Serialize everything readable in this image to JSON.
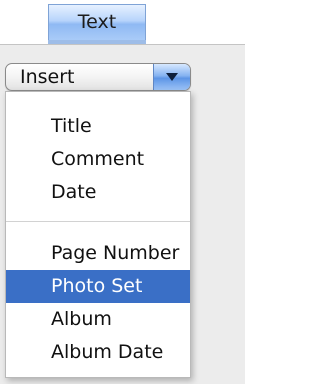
{
  "tab": {
    "label": "Text"
  },
  "popup": {
    "selected_value": "Insert",
    "arrow_icon": "popup-arrow-icon"
  },
  "menu": {
    "group1": [
      "Title",
      "Comment",
      "Date"
    ],
    "group2": [
      "Page Number",
      "Photo Set",
      "Album",
      "Album Date"
    ],
    "highlighted_item": "Photo Set",
    "highlight_color": "#3a6fc6"
  }
}
